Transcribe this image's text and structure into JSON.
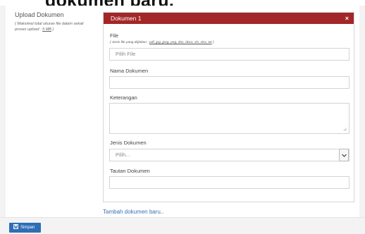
{
  "overlay": {
    "heading": "dokumen baru."
  },
  "upload": {
    "label": "Upload Dokumen",
    "note_prefix": "( Maksimal total ukuran file dalam sekali proses upload : ",
    "note_size": "5 MB",
    "note_suffix": " )"
  },
  "card": {
    "title": "Dokumen 1",
    "close_glyph": "×",
    "file": {
      "label": "File",
      "hint_prefix": "( Jenis file yang diijinkan : ",
      "hint_ext": "pdf, jpg, jpeg, png, doc, docx, xls, xlsx, txt",
      "hint_suffix": " )",
      "placeholder": "Pilih File"
    },
    "nama": {
      "label": "Nama Dokumen",
      "value": ""
    },
    "keterangan": {
      "label": "Keterangan",
      "value": ""
    },
    "jenis": {
      "label": "Jenis Dokumen",
      "selected": "Pilih..."
    },
    "tautan": {
      "label": "Tautan Dokumen",
      "value": ""
    }
  },
  "add_link": "Tambah dokumen baru..",
  "footer": {
    "save_label": "Simpan"
  },
  "colors": {
    "header": "#a32728",
    "primary": "#2f6db4",
    "link": "#3a6fb5"
  },
  "icons": {
    "close": "close-icon",
    "select": "chevron-down-icon",
    "save": "save-icon",
    "resize": "resize-grip-icon"
  }
}
